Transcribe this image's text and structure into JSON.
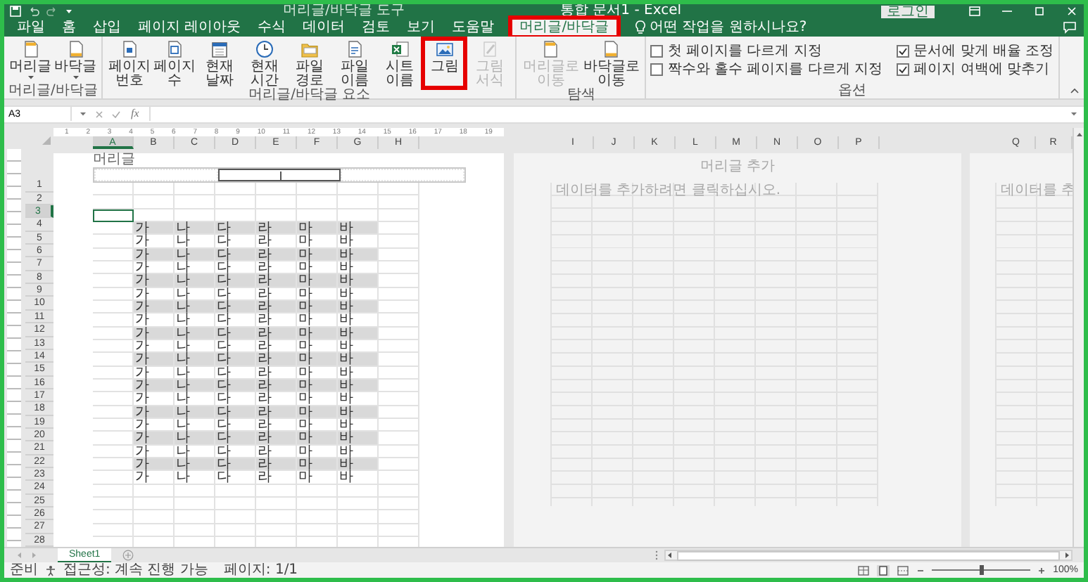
{
  "title_bar": {
    "context_label": "머리글/바닥글 도구",
    "title": "통합 문서1 - Excel",
    "login_button": "로그인"
  },
  "tabs": [
    {
      "label": "파일",
      "selected": false,
      "highlighted": false
    },
    {
      "label": "홈",
      "selected": false,
      "highlighted": false
    },
    {
      "label": "삽입",
      "selected": false,
      "highlighted": false
    },
    {
      "label": "페이지 레이아웃",
      "selected": false,
      "highlighted": false
    },
    {
      "label": "수식",
      "selected": false,
      "highlighted": false
    },
    {
      "label": "데이터",
      "selected": false,
      "highlighted": false
    },
    {
      "label": "검토",
      "selected": false,
      "highlighted": false
    },
    {
      "label": "보기",
      "selected": false,
      "highlighted": false
    },
    {
      "label": "도움말",
      "selected": false,
      "highlighted": false
    },
    {
      "label": "머리글/바닥글",
      "selected": true,
      "highlighted": true
    }
  ],
  "search": {
    "placeholder": "어떤 작업을 원하시나요?"
  },
  "ribbon_groups": [
    {
      "kind": "buttons",
      "label": "머리글/바닥글",
      "buttons": [
        {
          "label": "머리글",
          "dropdown": true,
          "disabled": false,
          "highlighted": false
        },
        {
          "label": "바닥글",
          "dropdown": true,
          "disabled": false,
          "highlighted": false
        }
      ]
    },
    {
      "kind": "buttons",
      "label": "머리글/바닥글 요소",
      "buttons": [
        {
          "label": "페이지 번호",
          "dropdown": false,
          "disabled": false,
          "highlighted": false
        },
        {
          "label": "페이지 수",
          "dropdown": false,
          "disabled": false,
          "highlighted": false
        },
        {
          "label": "현재 날짜",
          "dropdown": false,
          "disabled": false,
          "highlighted": false
        },
        {
          "label": "현재 시간",
          "dropdown": false,
          "disabled": false,
          "highlighted": false
        },
        {
          "label": "파일 경로",
          "dropdown": false,
          "disabled": false,
          "highlighted": false
        },
        {
          "label": "파일 이름",
          "dropdown": false,
          "disabled": false,
          "highlighted": false
        },
        {
          "label": "시트 이름",
          "dropdown": false,
          "disabled": false,
          "highlighted": false
        },
        {
          "label": "그림",
          "dropdown": false,
          "disabled": false,
          "highlighted": true
        },
        {
          "label": "그림 서식",
          "dropdown": false,
          "disabled": true,
          "highlighted": false
        }
      ]
    },
    {
      "kind": "buttons",
      "label": "탐색",
      "buttons": [
        {
          "label": "머리글로 이동",
          "dropdown": false,
          "disabled": true,
          "highlighted": false
        },
        {
          "label": "바닥글로 이동",
          "dropdown": false,
          "disabled": false,
          "highlighted": false
        }
      ]
    },
    {
      "kind": "options",
      "label": "옵션",
      "options": [
        {
          "label": "첫 페이지를 다르게 지정",
          "checked": false
        },
        {
          "label": "짝수와 홀수 페이지를 다르게 지정",
          "checked": false
        },
        {
          "label": "문서에 맞게 배율 조정",
          "checked": true
        },
        {
          "label": "페이지 여백에 맞추기",
          "checked": true
        }
      ]
    }
  ],
  "formula_bar": {
    "name_box": "A3",
    "function_button": "fx"
  },
  "ruler": [
    "1",
    "2",
    "3",
    "4",
    "5",
    "6",
    "7",
    "8",
    "9",
    "10",
    "11",
    "12",
    "13",
    "14",
    "15",
    "16",
    "17",
    "18",
    "19"
  ],
  "pages": [
    {
      "kind": "sheet",
      "header_label": "머리글",
      "columns": [
        {
          "label": "A",
          "selected": true
        },
        {
          "label": "B",
          "selected": false
        },
        {
          "label": "C",
          "selected": false
        },
        {
          "label": "D",
          "selected": false
        },
        {
          "label": "E",
          "selected": false
        },
        {
          "label": "F",
          "selected": false
        },
        {
          "label": "G",
          "selected": false
        },
        {
          "label": "H",
          "selected": false
        }
      ],
      "header_sections": [
        {
          "selected": false
        },
        {
          "selected": true
        },
        {
          "selected": false
        }
      ],
      "rows": [
        {
          "number": "1",
          "selected": false,
          "shaded": false
        },
        {
          "number": "2",
          "selected": false,
          "shaded": false
        },
        {
          "number": "3",
          "selected": true,
          "shaded": false
        },
        {
          "number": "4",
          "selected": false,
          "shaded": true,
          "cells": [
            "가",
            "나",
            "다",
            "라",
            "마",
            "바"
          ]
        },
        {
          "number": "5",
          "selected": false,
          "shaded": false,
          "cells": [
            "가",
            "나",
            "다",
            "라",
            "마",
            "바"
          ]
        },
        {
          "number": "6",
          "selected": false,
          "shaded": true,
          "cells": [
            "가",
            "나",
            "다",
            "라",
            "마",
            "바"
          ]
        },
        {
          "number": "7",
          "selected": false,
          "shaded": false,
          "cells": [
            "가",
            "나",
            "다",
            "라",
            "마",
            "바"
          ]
        },
        {
          "number": "8",
          "selected": false,
          "shaded": true,
          "cells": [
            "가",
            "나",
            "다",
            "라",
            "마",
            "바"
          ]
        },
        {
          "number": "9",
          "selected": false,
          "shaded": false,
          "cells": [
            "가",
            "나",
            "다",
            "라",
            "마",
            "바"
          ]
        },
        {
          "number": "10",
          "selected": false,
          "shaded": true,
          "cells": [
            "가",
            "나",
            "다",
            "라",
            "마",
            "바"
          ]
        },
        {
          "number": "11",
          "selected": false,
          "shaded": false,
          "cells": [
            "가",
            "나",
            "다",
            "라",
            "마",
            "바"
          ]
        },
        {
          "number": "12",
          "selected": false,
          "shaded": true,
          "cells": [
            "가",
            "나",
            "다",
            "라",
            "마",
            "바"
          ]
        },
        {
          "number": "13",
          "selected": false,
          "shaded": false,
          "cells": [
            "가",
            "나",
            "다",
            "라",
            "마",
            "바"
          ]
        },
        {
          "number": "14",
          "selected": false,
          "shaded": true,
          "cells": [
            "가",
            "나",
            "다",
            "라",
            "마",
            "바"
          ]
        },
        {
          "number": "15",
          "selected": false,
          "shaded": false,
          "cells": [
            "가",
            "나",
            "다",
            "라",
            "마",
            "바"
          ]
        },
        {
          "number": "16",
          "selected": false,
          "shaded": true,
          "cells": [
            "가",
            "나",
            "다",
            "라",
            "마",
            "바"
          ]
        },
        {
          "number": "17",
          "selected": false,
          "shaded": false,
          "cells": [
            "가",
            "나",
            "다",
            "라",
            "마",
            "바"
          ]
        },
        {
          "number": "18",
          "selected": false,
          "shaded": true,
          "cells": [
            "가",
            "나",
            "다",
            "라",
            "마",
            "바"
          ]
        },
        {
          "number": "19",
          "selected": false,
          "shaded": false,
          "cells": [
            "가",
            "나",
            "다",
            "라",
            "마",
            "바"
          ]
        },
        {
          "number": "20",
          "selected": false,
          "shaded": true,
          "cells": [
            "가",
            "나",
            "다",
            "라",
            "마",
            "바"
          ]
        },
        {
          "number": "21",
          "selected": false,
          "shaded": false,
          "cells": [
            "가",
            "나",
            "다",
            "라",
            "마",
            "바"
          ]
        },
        {
          "number": "22",
          "selected": false,
          "shaded": true,
          "cells": [
            "가",
            "나",
            "다",
            "라",
            "마",
            "바"
          ]
        },
        {
          "number": "23",
          "selected": false,
          "shaded": false,
          "cells": [
            "가",
            "나",
            "다",
            "라",
            "마",
            "바"
          ]
        },
        {
          "number": "24",
          "selected": false,
          "shaded": false
        },
        {
          "number": "25",
          "selected": false,
          "shaded": false
        },
        {
          "number": "26",
          "selected": false,
          "shaded": false
        },
        {
          "number": "27",
          "selected": false,
          "shaded": false
        },
        {
          "number": "28",
          "selected": false,
          "shaded": false
        }
      ]
    },
    {
      "kind": "blank",
      "header_hint": "머리글 추가",
      "data_hint": "데이터를 추가하려면 클릭하십시오.",
      "columns": [
        {
          "label": "I",
          "selected": false
        },
        {
          "label": "J",
          "selected": false
        },
        {
          "label": "K",
          "selected": false
        },
        {
          "label": "L",
          "selected": false
        },
        {
          "label": "M",
          "selected": false
        },
        {
          "label": "N",
          "selected": false
        },
        {
          "label": "O",
          "selected": false
        },
        {
          "label": "P",
          "selected": false
        }
      ]
    },
    {
      "kind": "blank",
      "data_hint": "데이터를 추",
      "columns": [
        {
          "label": "Q",
          "selected": false
        },
        {
          "label": "R",
          "selected": false
        }
      ]
    }
  ],
  "sheet_tabs": [
    {
      "label": "Sheet1",
      "selected": true
    }
  ],
  "status_bar": {
    "ready": "준비",
    "accessibility": "접근성: 계속 진행 가능",
    "page": "페이지: 1/1",
    "zoom": {
      "level": 0.5,
      "reading": "100%"
    }
  }
}
